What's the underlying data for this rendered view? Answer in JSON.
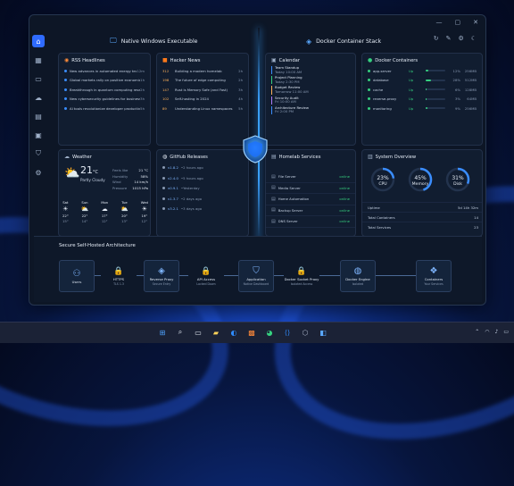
{
  "window": {
    "min": "—",
    "max": "▢",
    "close": "✕"
  },
  "headers": {
    "left": "Native Windows Executable",
    "right": "Docker Container Stack"
  },
  "rss": {
    "title": "RSS Headlines",
    "items": [
      {
        "text": "New advances in automated energy technology",
        "time": "12m"
      },
      {
        "text": "Global markets rally on positive economic data",
        "time": "1h"
      },
      {
        "text": "Breakthrough in quantum computing research",
        "time": "2h"
      },
      {
        "text": "New cybersecurity guidelines for businesses",
        "time": "3h"
      },
      {
        "text": "AI tools revolutionize developer productivity",
        "time": "5h"
      }
    ]
  },
  "hn": {
    "title": "Hacker News",
    "items": [
      {
        "n": "312",
        "text": "Building a modern homelab",
        "time": "2h"
      },
      {
        "n": "198",
        "text": "The future of edge computing",
        "time": "2h"
      },
      {
        "n": "147",
        "text": "Rust is Memory Safe (and Fast)",
        "time": "3h"
      },
      {
        "n": "102",
        "text": "Self-hosting in 2024",
        "time": "4h"
      },
      {
        "n": "89",
        "text": "Understanding Linux namespaces",
        "time": "5h"
      }
    ]
  },
  "calendar": {
    "title": "Calendar",
    "items": [
      {
        "name": "Team Standup",
        "time": "Today 10:00 AM"
      },
      {
        "name": "Project Planning",
        "time": "Today 2:30 PM"
      },
      {
        "name": "Budget Review",
        "time": "Tomorrow 11:00 AM"
      },
      {
        "name": "Security Audit",
        "time": "Fri 10:00 AM"
      },
      {
        "name": "Architecture Review",
        "time": "Fri 2:00 PM"
      }
    ]
  },
  "docker": {
    "title": "Docker Containers",
    "items": [
      {
        "name": "app-server",
        "status": "Up",
        "pct": "12%",
        "pct_value": 0.12,
        "mem": "256MB"
      },
      {
        "name": "database",
        "status": "Up",
        "pct": "28%",
        "pct_value": 0.28,
        "mem": "512MB"
      },
      {
        "name": "cache",
        "status": "Up",
        "pct": "6%",
        "pct_value": 0.06,
        "mem": "128MB"
      },
      {
        "name": "reverse-proxy",
        "status": "Up",
        "pct": "3%",
        "pct_value": 0.03,
        "mem": "64MB"
      },
      {
        "name": "monitoring",
        "status": "Up",
        "pct": "9%",
        "pct_value": 0.09,
        "mem": "256MB"
      }
    ]
  },
  "weather": {
    "title": "Weather",
    "temp": "21",
    "unit": "°C",
    "cond": "Partly Cloudy",
    "stats": [
      {
        "k": "Feels like",
        "v": "21 °C"
      },
      {
        "k": "Humidity",
        "v": "58%"
      },
      {
        "k": "Wind",
        "v": "14 km/h"
      },
      {
        "k": "Pressure",
        "v": "1015 hPa"
      }
    ],
    "days": [
      {
        "d": "Sat",
        "hi": "22°",
        "lo": "15°"
      },
      {
        "d": "Sun",
        "hi": "22°",
        "lo": "14°"
      },
      {
        "d": "Mon",
        "hi": "17°",
        "lo": "12°"
      },
      {
        "d": "Tue",
        "hi": "20°",
        "lo": "13°"
      },
      {
        "d": "Wed",
        "hi": "19°",
        "lo": "12°"
      }
    ]
  },
  "github": {
    "title": "GitHub Releases",
    "items": [
      {
        "v": "v1.8.2",
        "t": "2 hours ago"
      },
      {
        "v": "v2.4.0",
        "t": "5 hours ago"
      },
      {
        "v": "v0.9.1",
        "t": "Yesterday"
      },
      {
        "v": "v1.3.7",
        "t": "2 days ago"
      },
      {
        "v": "v3.2.1",
        "t": "3 days ago"
      }
    ]
  },
  "homelab": {
    "title": "Homelab Services",
    "items": [
      {
        "name": "File Server",
        "status": "online"
      },
      {
        "name": "Media Server",
        "status": "online"
      },
      {
        "name": "Home Automation",
        "status": "online"
      },
      {
        "name": "Backup Server",
        "status": "online"
      },
      {
        "name": "DNS Server",
        "status": "online"
      }
    ]
  },
  "system": {
    "title": "System Overview",
    "gauges": [
      {
        "label": "CPU",
        "pct": "23%",
        "value": 0.23
      },
      {
        "label": "Memory",
        "pct": "45%",
        "value": 0.45
      },
      {
        "label": "Disk",
        "pct": "31%",
        "value": 0.31
      }
    ],
    "rows": [
      {
        "k": "Uptime",
        "v": "5d 14h 32m"
      },
      {
        "k": "Total Containers",
        "v": "14"
      },
      {
        "k": "Total Services",
        "v": "23"
      }
    ]
  },
  "arch": {
    "title": "Secure Self-Hosted Architecture",
    "nodes": [
      {
        "label": "Users",
        "sub": "",
        "icon": "users-icon"
      },
      {
        "label": "HTTPS",
        "sub": "TLS 1.3",
        "icon": "lock-icon"
      },
      {
        "label": "Reverse Proxy",
        "sub": "Secure Entry",
        "icon": "cube-icon"
      },
      {
        "label": "API Access",
        "sub": "Locked Down",
        "icon": "lock-icon"
      },
      {
        "label": "Application",
        "sub": "Native Dashboard",
        "icon": "shield-icon"
      },
      {
        "label": "Docker Socket Proxy",
        "sub": "Isolated Access",
        "icon": "lock-icon"
      },
      {
        "label": "Docker Engine",
        "sub": "Isolated",
        "icon": "docker-icon"
      },
      {
        "label": "Containers",
        "sub": "Your Services",
        "icon": "containers-icon"
      }
    ]
  }
}
